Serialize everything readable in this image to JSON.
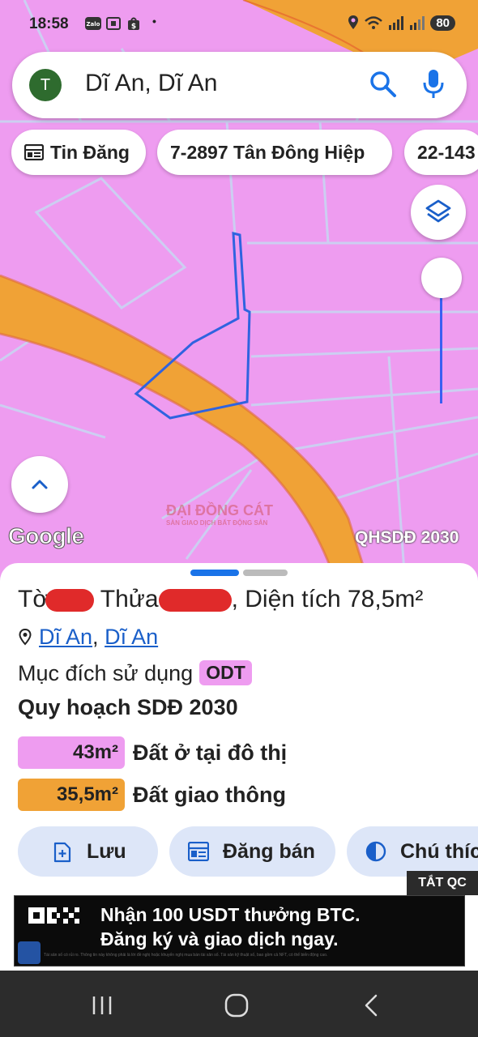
{
  "status_bar": {
    "time": "18:58",
    "app_icons": [
      "zalo-icon",
      "scan-icon",
      "shop-icon"
    ],
    "dot": "•",
    "battery": "80"
  },
  "search": {
    "avatar_letter": "T",
    "query": "Dĩ An, Dĩ An"
  },
  "chips": [
    {
      "label": "Tin Đăng",
      "icon": "newspaper-icon"
    },
    {
      "label": "7-2897 Tân Đông Hiệp"
    },
    {
      "label": "22-143"
    }
  ],
  "map": {
    "attribution": "Google",
    "layer_label": "QHSDĐ 2030",
    "watermark": "ĐẠI ĐỒNG CÁT",
    "watermark_sub": "SÀN GIAO DỊCH BẤT ĐỘNG SẢN",
    "colors": {
      "residential": "#ee9cf0",
      "road": "#f0a236",
      "parcel_outline": "#2f63e0"
    }
  },
  "parcel": {
    "prefix_to": "Tờ",
    "label_thua": "Thửa",
    "area_text": ", Diện tích 78,5m²",
    "location_commune": "Dĩ An",
    "location_sep": ",",
    "location_district": "Dĩ An",
    "purpose_label": "Mục đích sử dụng",
    "purpose_code": "ODT",
    "plan_title": "Quy hoạch SDĐ 2030",
    "land_uses": [
      {
        "area": "43m²",
        "label": "Đất ở tại đô thị",
        "color": "#ee9cf0"
      },
      {
        "area": "35,5m²",
        "label": "Đất giao thông",
        "color": "#f0a236"
      }
    ]
  },
  "actions": [
    {
      "label": "Lưu",
      "icon": "save-icon"
    },
    {
      "label": "Đăng bán",
      "icon": "listing-icon"
    },
    {
      "label": "Chú thích",
      "icon": "contrast-icon"
    }
  ],
  "ad": {
    "close_label": "TẮT QC",
    "brand": "OKX",
    "line1": "Nhận 100 USDT thưởng BTC.",
    "line2": "Đăng ký và giao dịch ngay.",
    "fine_print": "Tài sản số có rủi ro. Thông tin này không phải là lời đề nghị hoặc khuyến nghị mua bán tài sản số. Tài sản kỹ thuật số, bao gồm cả NFT, có thể biến động cao."
  }
}
